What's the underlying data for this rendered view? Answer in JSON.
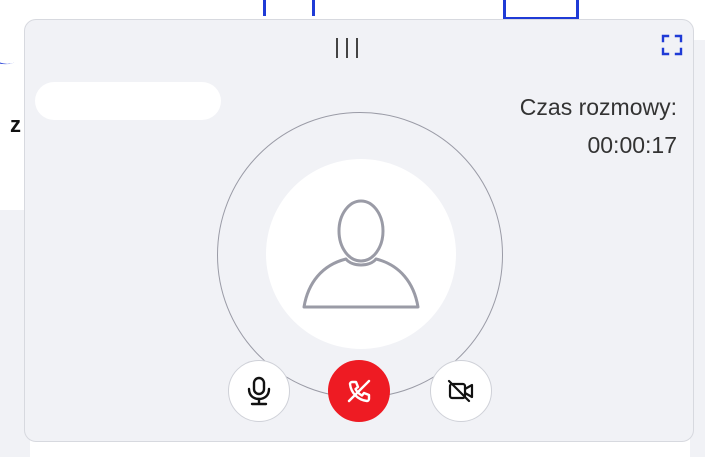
{
  "background": {
    "partial_letter": "z"
  },
  "call": {
    "caller_name": "",
    "timer_label": "Czas rozmowy:",
    "timer_value": "00:00:17"
  },
  "icons": {
    "drag": "drag-handle-icon",
    "fullscreen": "fullscreen-icon",
    "avatar": "user-avatar-icon",
    "mic": "microphone-icon",
    "hangup": "phone-hangup-icon",
    "camera": "camera-off-icon"
  },
  "colors": {
    "panel_bg": "#f1f2f6",
    "hangup_red": "#ee1b23",
    "accent_blue": "#1f3bd6",
    "avatar_outline": "#9a9ba6"
  }
}
